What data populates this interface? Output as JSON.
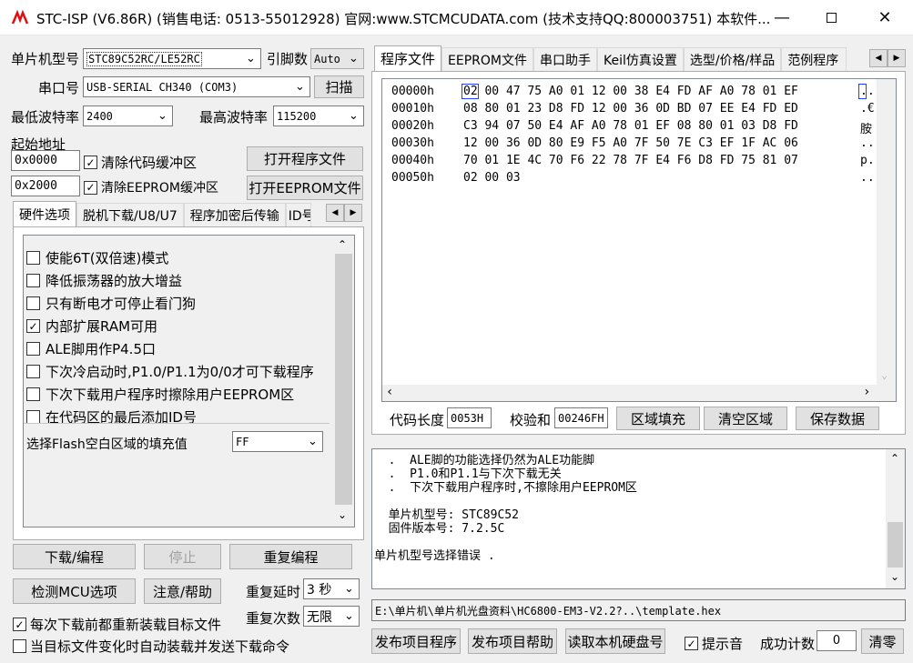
{
  "window": {
    "title": "STC-ISP (V6.86R) (销售电话: 0513-55012928) 官网:www.STCMCUDATA.com  (技术支持QQ:800003751) 本软件..."
  },
  "left": {
    "mcu_type_label": "单片机型号",
    "mcu_type_value": "STC89C52RC/LE52RC",
    "pin_count_label": "引脚数",
    "pin_count_value": "Auto",
    "port_label": "串口号",
    "port_value": "USB-SERIAL CH340 (COM3)",
    "scan_button": "扫描",
    "min_baud_label": "最低波特率",
    "min_baud_value": "2400",
    "max_baud_label": "最高波特率",
    "max_baud_value": "115200",
    "start_addr_label": "起始地址",
    "code_addr_value": "0x0000",
    "clear_code_label": "清除代码缓冲区",
    "open_program_button": "打开程序文件",
    "eeprom_addr_value": "0x2000",
    "clear_eeprom_label": "清除EEPROM缓冲区",
    "open_eeprom_button": "打开EEPROM文件"
  },
  "options_tabs": [
    "硬件选项",
    "脱机下载/U8/U7",
    "程序加密后传输",
    "ID号"
  ],
  "hardware_options": [
    {
      "label": "使能6T(双倍速)模式",
      "checked": false
    },
    {
      "label": "降低振荡器的放大增益",
      "checked": false
    },
    {
      "label": "只有断电才可停止看门狗",
      "checked": false
    },
    {
      "label": "内部扩展RAM可用",
      "checked": true
    },
    {
      "label": "ALE脚用作P4.5口",
      "checked": false
    },
    {
      "label": "下次冷启动时,P1.0/P1.1为0/0才可下载程序",
      "checked": false
    },
    {
      "label": "下次下载用户程序时擦除用户EEPROM区",
      "checked": false
    },
    {
      "label": "在代码区的最后添加ID号",
      "checked": false
    }
  ],
  "fill_value_label": "选择Flash空白区域的填充值",
  "fill_value": "FF",
  "actions": {
    "download": "下载/编程",
    "stop": "停止",
    "reprogram": "重复编程",
    "check_mcu": "检测MCU选项",
    "help": "注意/帮助",
    "repeat_delay_label": "重复延时",
    "repeat_delay_value": "3 秒",
    "repeat_count_label": "重复次数",
    "repeat_count_value": "无限",
    "reload_label": "每次下载前都重新装载目标文件",
    "auto_send_label": "当目标文件变化时自动装载并发送下载命令"
  },
  "right_tabs": [
    "程序文件",
    "EEPROM文件",
    "串口助手",
    "Keil仿真设置",
    "选型/价格/样品",
    "范例程序"
  ],
  "hex_rows": [
    {
      "addr": "00000h",
      "bytes": "02 00 47 75 A0 01 12 00 38 E4 FD AF A0 78 01 EF",
      "ascii": ".."
    },
    {
      "addr": "00010h",
      "bytes": "08 80 01 23 D8 FD 12 00 36 0D BD 07 EE E4 FD ED",
      "ascii": ".€"
    },
    {
      "addr": "00020h",
      "bytes": "C3 94 07 50 E4 AF A0 78 01 EF 08 80 01 03 D8 FD",
      "ascii": "胺"
    },
    {
      "addr": "00030h",
      "bytes": "12 00 36 0D 80 E9 F5 A0 7F 50 7E C3 EF 1F AC 06",
      "ascii": ".."
    },
    {
      "addr": "00040h",
      "bytes": "70 01 1E 4C 70 F6 22 78 7F E4 F6 D8 FD 75 81 07",
      "ascii": "p."
    },
    {
      "addr": "00050h",
      "bytes": "02 00 03",
      "ascii": ".."
    }
  ],
  "code_bar": {
    "code_len_label": "代码长度",
    "code_len_value": "0053H",
    "checksum_label": "校验和",
    "checksum_value": "00246FH",
    "fill_button": "区域填充",
    "clear_button": "清空区域",
    "save_button": "保存数据"
  },
  "log_lines": [
    "  .  ALE脚的功能选择仍然为ALE功能脚",
    "  .  P1.0和P1.1与下次下载无关",
    "  .  下次下载用户程序时,不擦除用户EEPROM区",
    "",
    "  单片机型号: STC89C52",
    "  固件版本号: 7.2.5C",
    "",
    "单片机型号选择错误 ."
  ],
  "file_path": "E:\\单片机\\单片机光盘资料\\HC6800-EM3-V2.2?..\\template.hex",
  "bottom": {
    "publish_program": "发布项目程序",
    "publish_help": "发布项目帮助",
    "read_disk_id": "读取本机硬盘号",
    "sound_label": "提示音",
    "success_label": "成功计数",
    "success_value": "0",
    "clear_button": "清零"
  }
}
